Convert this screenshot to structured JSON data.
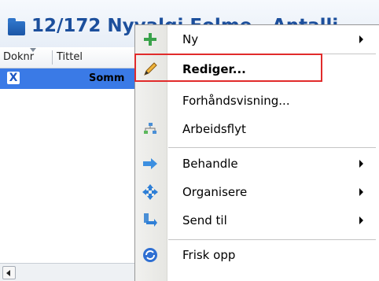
{
  "window": {
    "title": "12/172 Nyvalgi Eolme - Antalli..."
  },
  "table": {
    "columns": [
      "Doknr",
      "Tittel"
    ],
    "selected_row": {
      "icon_glyph": "X",
      "title": "Somm"
    }
  },
  "context_menu": {
    "items": [
      {
        "label": "Ny",
        "icon": "plus-icon",
        "submenu": true
      },
      {
        "label": "Rediger...",
        "icon": "pencil-icon",
        "submenu": false,
        "bold": true
      },
      {
        "label": "Forhåndsvisning...",
        "icon": "",
        "submenu": false
      },
      {
        "label": "Arbeidsflyt",
        "icon": "workflow-icon",
        "submenu": false
      },
      {
        "label": "Behandle",
        "icon": "arrow-right-icon",
        "submenu": true
      },
      {
        "label": "Organisere",
        "icon": "move-icon",
        "submenu": true
      },
      {
        "label": "Send til",
        "icon": "send-to-icon",
        "submenu": true
      },
      {
        "label": "Frisk opp",
        "icon": "refresh-icon",
        "submenu": false
      }
    ]
  },
  "colors": {
    "selection": "#3a7ae6",
    "title_text": "#1c4f9c",
    "highlight_box": "#e12b2b",
    "icon_green": "#3aa24a"
  }
}
